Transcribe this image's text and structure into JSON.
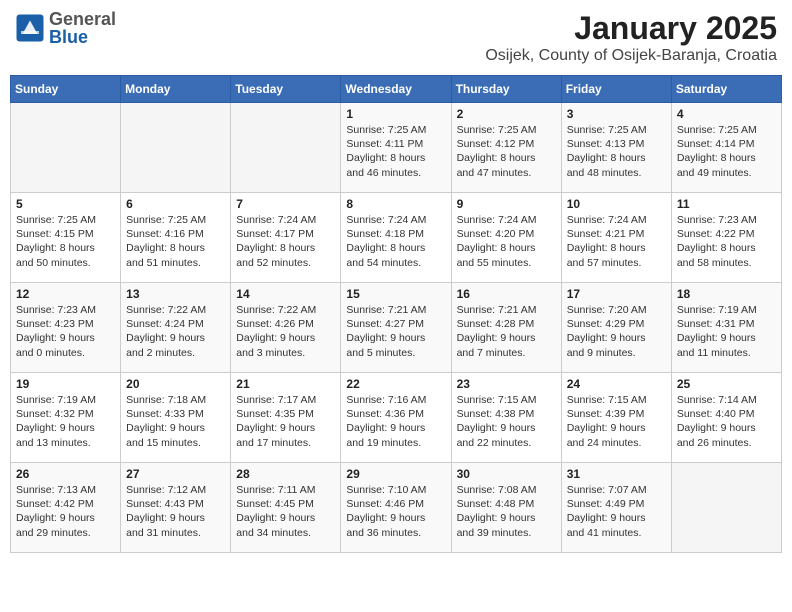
{
  "header": {
    "logo_general": "General",
    "logo_blue": "Blue",
    "title": "January 2025",
    "subtitle": "Osijek, County of Osijek-Baranja, Croatia"
  },
  "weekdays": [
    "Sunday",
    "Monday",
    "Tuesday",
    "Wednesday",
    "Thursday",
    "Friday",
    "Saturday"
  ],
  "weeks": [
    [
      {
        "day": "",
        "info": ""
      },
      {
        "day": "",
        "info": ""
      },
      {
        "day": "",
        "info": ""
      },
      {
        "day": "1",
        "info": "Sunrise: 7:25 AM\nSunset: 4:11 PM\nDaylight: 8 hours\nand 46 minutes."
      },
      {
        "day": "2",
        "info": "Sunrise: 7:25 AM\nSunset: 4:12 PM\nDaylight: 8 hours\nand 47 minutes."
      },
      {
        "day": "3",
        "info": "Sunrise: 7:25 AM\nSunset: 4:13 PM\nDaylight: 8 hours\nand 48 minutes."
      },
      {
        "day": "4",
        "info": "Sunrise: 7:25 AM\nSunset: 4:14 PM\nDaylight: 8 hours\nand 49 minutes."
      }
    ],
    [
      {
        "day": "5",
        "info": "Sunrise: 7:25 AM\nSunset: 4:15 PM\nDaylight: 8 hours\nand 50 minutes."
      },
      {
        "day": "6",
        "info": "Sunrise: 7:25 AM\nSunset: 4:16 PM\nDaylight: 8 hours\nand 51 minutes."
      },
      {
        "day": "7",
        "info": "Sunrise: 7:24 AM\nSunset: 4:17 PM\nDaylight: 8 hours\nand 52 minutes."
      },
      {
        "day": "8",
        "info": "Sunrise: 7:24 AM\nSunset: 4:18 PM\nDaylight: 8 hours\nand 54 minutes."
      },
      {
        "day": "9",
        "info": "Sunrise: 7:24 AM\nSunset: 4:20 PM\nDaylight: 8 hours\nand 55 minutes."
      },
      {
        "day": "10",
        "info": "Sunrise: 7:24 AM\nSunset: 4:21 PM\nDaylight: 8 hours\nand 57 minutes."
      },
      {
        "day": "11",
        "info": "Sunrise: 7:23 AM\nSunset: 4:22 PM\nDaylight: 8 hours\nand 58 minutes."
      }
    ],
    [
      {
        "day": "12",
        "info": "Sunrise: 7:23 AM\nSunset: 4:23 PM\nDaylight: 9 hours\nand 0 minutes."
      },
      {
        "day": "13",
        "info": "Sunrise: 7:22 AM\nSunset: 4:24 PM\nDaylight: 9 hours\nand 2 minutes."
      },
      {
        "day": "14",
        "info": "Sunrise: 7:22 AM\nSunset: 4:26 PM\nDaylight: 9 hours\nand 3 minutes."
      },
      {
        "day": "15",
        "info": "Sunrise: 7:21 AM\nSunset: 4:27 PM\nDaylight: 9 hours\nand 5 minutes."
      },
      {
        "day": "16",
        "info": "Sunrise: 7:21 AM\nSunset: 4:28 PM\nDaylight: 9 hours\nand 7 minutes."
      },
      {
        "day": "17",
        "info": "Sunrise: 7:20 AM\nSunset: 4:29 PM\nDaylight: 9 hours\nand 9 minutes."
      },
      {
        "day": "18",
        "info": "Sunrise: 7:19 AM\nSunset: 4:31 PM\nDaylight: 9 hours\nand 11 minutes."
      }
    ],
    [
      {
        "day": "19",
        "info": "Sunrise: 7:19 AM\nSunset: 4:32 PM\nDaylight: 9 hours\nand 13 minutes."
      },
      {
        "day": "20",
        "info": "Sunrise: 7:18 AM\nSunset: 4:33 PM\nDaylight: 9 hours\nand 15 minutes."
      },
      {
        "day": "21",
        "info": "Sunrise: 7:17 AM\nSunset: 4:35 PM\nDaylight: 9 hours\nand 17 minutes."
      },
      {
        "day": "22",
        "info": "Sunrise: 7:16 AM\nSunset: 4:36 PM\nDaylight: 9 hours\nand 19 minutes."
      },
      {
        "day": "23",
        "info": "Sunrise: 7:15 AM\nSunset: 4:38 PM\nDaylight: 9 hours\nand 22 minutes."
      },
      {
        "day": "24",
        "info": "Sunrise: 7:15 AM\nSunset: 4:39 PM\nDaylight: 9 hours\nand 24 minutes."
      },
      {
        "day": "25",
        "info": "Sunrise: 7:14 AM\nSunset: 4:40 PM\nDaylight: 9 hours\nand 26 minutes."
      }
    ],
    [
      {
        "day": "26",
        "info": "Sunrise: 7:13 AM\nSunset: 4:42 PM\nDaylight: 9 hours\nand 29 minutes."
      },
      {
        "day": "27",
        "info": "Sunrise: 7:12 AM\nSunset: 4:43 PM\nDaylight: 9 hours\nand 31 minutes."
      },
      {
        "day": "28",
        "info": "Sunrise: 7:11 AM\nSunset: 4:45 PM\nDaylight: 9 hours\nand 34 minutes."
      },
      {
        "day": "29",
        "info": "Sunrise: 7:10 AM\nSunset: 4:46 PM\nDaylight: 9 hours\nand 36 minutes."
      },
      {
        "day": "30",
        "info": "Sunrise: 7:08 AM\nSunset: 4:48 PM\nDaylight: 9 hours\nand 39 minutes."
      },
      {
        "day": "31",
        "info": "Sunrise: 7:07 AM\nSunset: 4:49 PM\nDaylight: 9 hours\nand 41 minutes."
      },
      {
        "day": "",
        "info": ""
      }
    ]
  ]
}
